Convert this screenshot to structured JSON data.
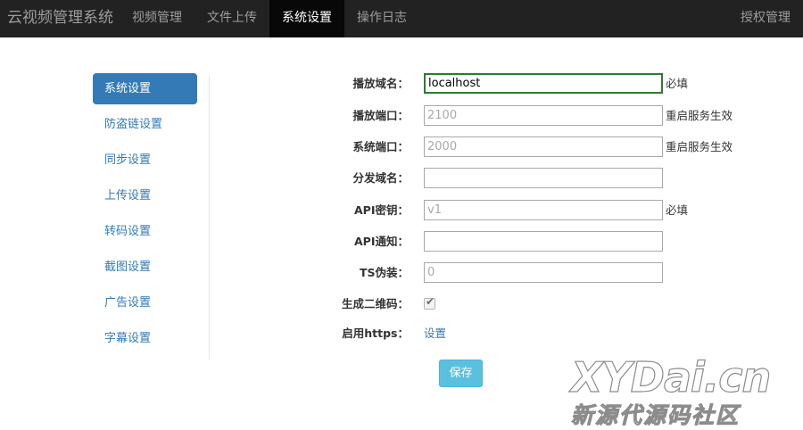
{
  "topbar": {
    "brand": "云视频管理系统",
    "nav": [
      {
        "label": "视频管理",
        "active": false
      },
      {
        "label": "文件上传",
        "active": false
      },
      {
        "label": "系统设置",
        "active": true
      },
      {
        "label": "操作日志",
        "active": false
      }
    ],
    "right_label": "授权管理"
  },
  "sidebar": {
    "items": [
      {
        "label": "系统设置",
        "active": true
      },
      {
        "label": "防盗链设置",
        "active": false
      },
      {
        "label": "同步设置",
        "active": false
      },
      {
        "label": "上传设置",
        "active": false
      },
      {
        "label": "转码设置",
        "active": false
      },
      {
        "label": "截图设置",
        "active": false
      },
      {
        "label": "广告设置",
        "active": false
      },
      {
        "label": "字幕设置",
        "active": false
      }
    ]
  },
  "form": {
    "play_domain": {
      "label": "播放域名：",
      "value": "localhost",
      "placeholder": "",
      "hint": "必填"
    },
    "play_port": {
      "label": "播放端口：",
      "value": "",
      "placeholder": "2100",
      "hint": "重启服务生效"
    },
    "system_port": {
      "label": "系统端口：",
      "value": "",
      "placeholder": "2000",
      "hint": "重启服务生效"
    },
    "dist_domain": {
      "label": "分发域名：",
      "value": "",
      "placeholder": "",
      "hint": ""
    },
    "api_key": {
      "label": "API密钥：",
      "value": "",
      "placeholder": "v1",
      "hint": "必填"
    },
    "api_notify": {
      "label": "API通知：",
      "value": "",
      "placeholder": "",
      "hint": ""
    },
    "ts_disguise": {
      "label": "TS伪装：",
      "value": "",
      "placeholder": "0",
      "hint": ""
    },
    "qrcode": {
      "label": "生成二维码：",
      "checked": true
    },
    "https": {
      "label": "启用https：",
      "link": "设置"
    },
    "save_label": "保存"
  },
  "watermark": {
    "line1": "XYDai.cn",
    "line2": "新源代源码社区"
  },
  "colors": {
    "topbar_bg": "#222222",
    "accent": "#337ab7",
    "save_button": "#5bc0de",
    "focus_border": "#2f7a2f"
  }
}
